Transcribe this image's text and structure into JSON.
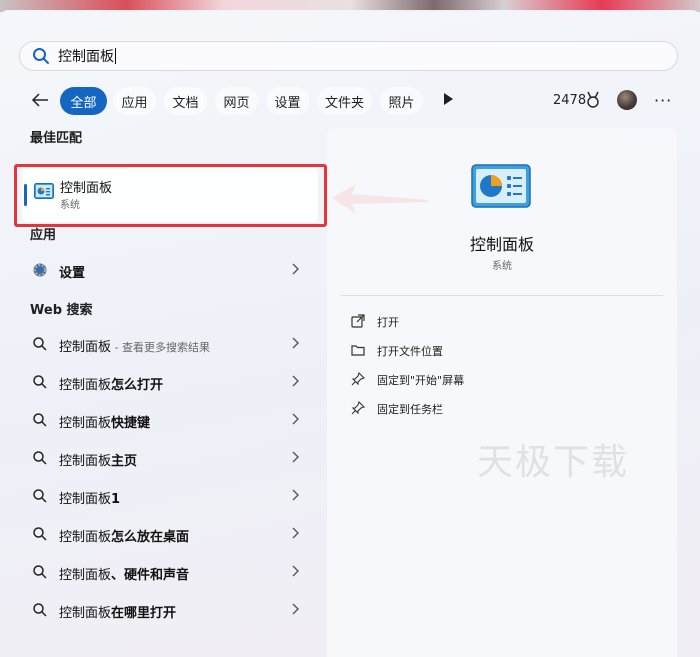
{
  "search": {
    "value": "控制面板"
  },
  "filters": {
    "chips": [
      "全部",
      "应用",
      "文档",
      "网页",
      "设置",
      "文件夹",
      "照片"
    ],
    "points": "2478"
  },
  "left": {
    "best_match_title": "最佳匹配",
    "best_match": {
      "name": "控制面板",
      "type": "系统"
    },
    "apps_title": "应用",
    "apps": [
      {
        "label": "设置"
      }
    ],
    "web_title": "Web 搜索",
    "web_results": [
      {
        "prefix": "控制面板",
        "bold": "",
        "hint": " - 查看更多搜索结果"
      },
      {
        "prefix": "控制面板",
        "bold": "怎么打开",
        "hint": ""
      },
      {
        "prefix": "控制面板",
        "bold": "快捷键",
        "hint": ""
      },
      {
        "prefix": "控制面板",
        "bold": "主页",
        "hint": ""
      },
      {
        "prefix": "控制面板",
        "bold": "1",
        "hint": ""
      },
      {
        "prefix": "控制面板",
        "bold": "怎么放在桌面",
        "hint": ""
      },
      {
        "prefix": "控制面板",
        "bold": "、硬件和声音",
        "hint": ""
      },
      {
        "prefix": "控制面板",
        "bold": "在哪里打开",
        "hint": ""
      }
    ]
  },
  "right": {
    "title": "控制面板",
    "subtitle": "系统",
    "actions": [
      "打开",
      "打开文件位置",
      "固定到\"开始\"屏幕",
      "固定到任务栏"
    ],
    "watermark": "天极下载"
  },
  "colors": {
    "accent": "#1466c2",
    "annotation_red": "#e5343a"
  }
}
